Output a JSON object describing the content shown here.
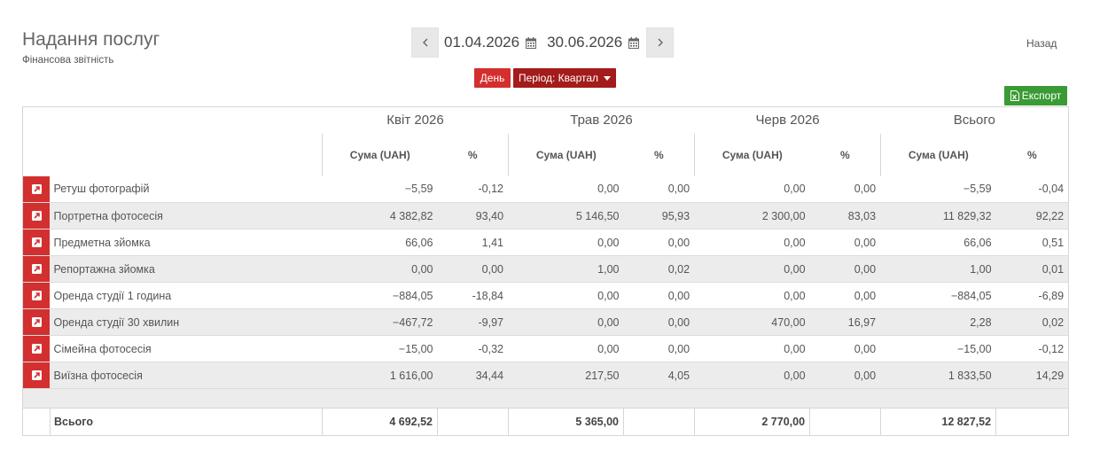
{
  "header": {
    "title": "Надання послуг",
    "subtitle": "Фінансова звітність",
    "back_label": "Назад"
  },
  "datebar": {
    "prev_icon": "chevron-left-icon",
    "next_icon": "chevron-right-icon",
    "date_from": "01.04.2026",
    "date_to": "30.06.2026",
    "calendar_icon": "calendar-icon"
  },
  "controls": {
    "day_label": "День",
    "period_label": "Період: Квартал",
    "export_label": "Експорт"
  },
  "colors": {
    "accent_red": "#d32f2f",
    "dark_red": "#a31b1b",
    "export_green": "#3a9b35",
    "row_alt": "#ececec"
  },
  "table": {
    "groups": [
      "Квіт 2026",
      "Трав 2026",
      "Черв 2026",
      "Всього"
    ],
    "sum_header": "Сума (UAH)",
    "pct_header": "%",
    "rows": [
      {
        "name": "Ретуш фотографій",
        "values": [
          "−5,59",
          "-0,12",
          "0,00",
          "0,00",
          "0,00",
          "0,00",
          "−5,59",
          "-0,04"
        ]
      },
      {
        "name": "Портретна фотосесія",
        "values": [
          "4 382,82",
          "93,40",
          "5 146,50",
          "95,93",
          "2 300,00",
          "83,03",
          "11 829,32",
          "92,22"
        ]
      },
      {
        "name": "Предметна зйомка",
        "values": [
          "66,06",
          "1,41",
          "0,00",
          "0,00",
          "0,00",
          "0,00",
          "66,06",
          "0,51"
        ]
      },
      {
        "name": "Репортажна зйомка",
        "values": [
          "0,00",
          "0,00",
          "1,00",
          "0,02",
          "0,00",
          "0,00",
          "1,00",
          "0,01"
        ]
      },
      {
        "name": "Оренда студії 1 година",
        "values": [
          "−884,05",
          "-18,84",
          "0,00",
          "0,00",
          "0,00",
          "0,00",
          "−884,05",
          "-6,89"
        ]
      },
      {
        "name": "Оренда студії 30 хвилин",
        "values": [
          "−467,72",
          "-9,97",
          "0,00",
          "0,00",
          "470,00",
          "16,97",
          "2,28",
          "0,02"
        ]
      },
      {
        "name": "Сімейна фотосесія",
        "values": [
          "−15,00",
          "-0,32",
          "0,00",
          "0,00",
          "0,00",
          "0,00",
          "−15,00",
          "-0,12"
        ]
      },
      {
        "name": "Виїзна фотосесія",
        "values": [
          "1 616,00",
          "34,44",
          "217,50",
          "4,05",
          "0,00",
          "0,00",
          "1 833,50",
          "14,29"
        ]
      }
    ],
    "total": {
      "label": "Всього",
      "values": [
        "4 692,52",
        "",
        "5 365,00",
        "",
        "2 770,00",
        "",
        "12 827,52",
        ""
      ]
    }
  }
}
